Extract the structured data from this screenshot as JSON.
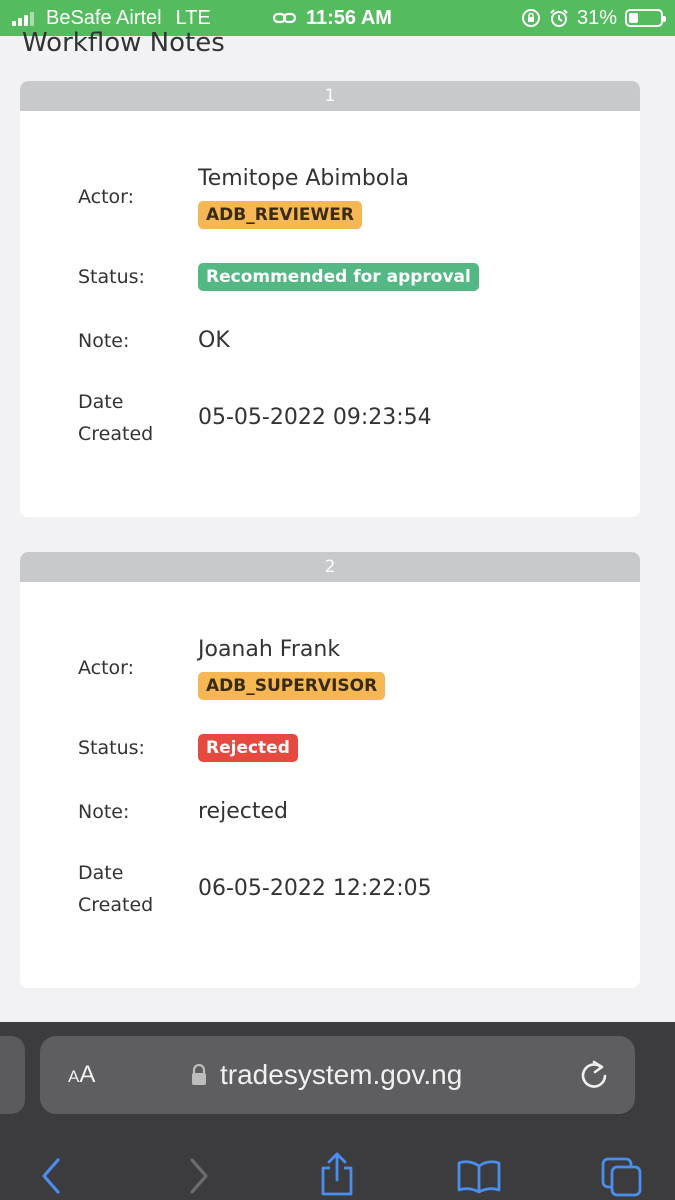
{
  "status_bar": {
    "carrier": "BeSafe Airtel",
    "network": "LTE",
    "time": "11:56 AM",
    "battery_percent": "31%",
    "battery_level": 0.31
  },
  "page": {
    "title": "Workflow Notes"
  },
  "labels": {
    "actor": "Actor:",
    "status": "Status:",
    "note": "Note:",
    "date_line1": "Date",
    "date_line2": "Created"
  },
  "notes": [
    {
      "index": "1",
      "actor": "Temitope Abimbola",
      "role": "ADB_REVIEWER",
      "status": "Recommended for approval",
      "status_color": "#53b883",
      "note": "OK",
      "date_created": "05-05-2022 09:23:54"
    },
    {
      "index": "2",
      "actor": "Joanah Frank",
      "role": "ADB_SUPERVISOR",
      "status": "Rejected",
      "status_color": "#e5493f",
      "note": "rejected",
      "date_created": "06-05-2022 12:22:05"
    }
  ],
  "browser": {
    "text_size_label_small": "A",
    "text_size_label_large": "A",
    "url": "tradesystem.gov.ng",
    "accent_color": "#4a8ff0"
  }
}
